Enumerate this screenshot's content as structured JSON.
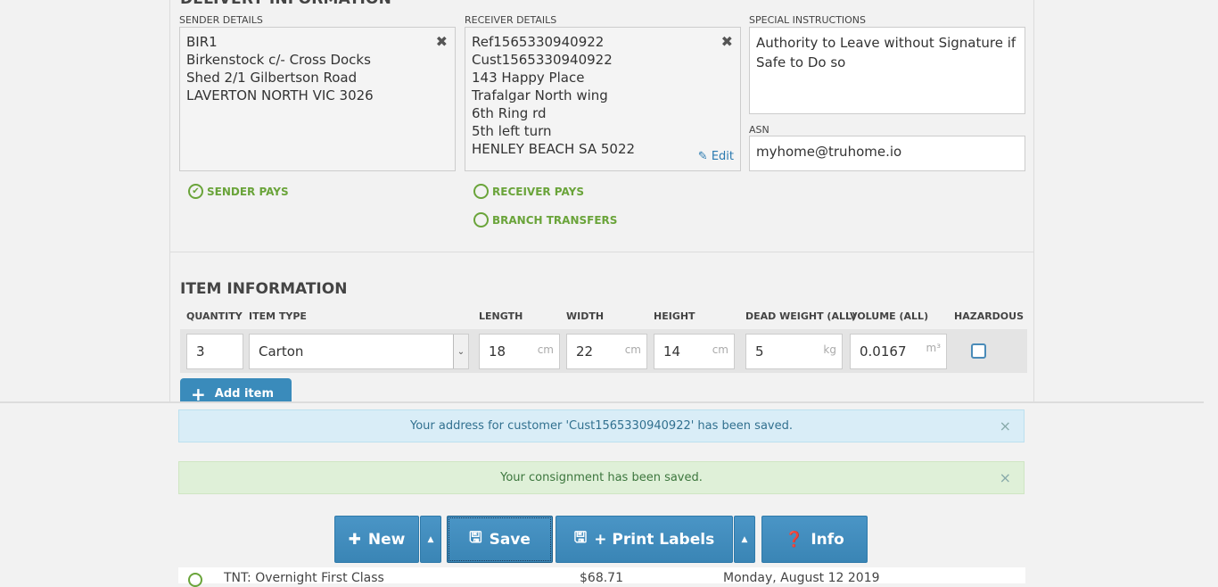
{
  "delivery": {
    "heading": "DELIVERY INFORMATION",
    "sender": {
      "label": "SENDER DETAILS",
      "lines": [
        "BIR1",
        "Birkenstock c/- Cross Docks",
        "Shed 2/1 Gilbertson Road",
        "LAVERTON NORTH VIC 3026"
      ]
    },
    "receiver": {
      "label": "RECEIVER DETAILS",
      "lines": [
        "Ref1565330940922",
        "Cust1565330940922",
        "143 Happy Place",
        "Trafalgar North wing",
        "6th Ring rd",
        "5th left turn",
        "HENLEY BEACH SA 5022"
      ],
      "edit_label": "Edit"
    },
    "special": {
      "label": "SPECIAL INSTRUCTIONS",
      "value": "Authority to Leave without Signature if Safe to Do so"
    },
    "asn": {
      "label": "ASN",
      "value": "myhome@truhome.io"
    },
    "payment": {
      "sender_pays": "SENDER PAYS",
      "receiver_pays": "RECEIVER PAYS",
      "branch_transfers": "BRANCH TRANSFERS",
      "selected": "sender_pays"
    }
  },
  "items": {
    "heading": "ITEM INFORMATION",
    "columns": [
      "QUANTITY",
      "ITEM TYPE",
      "LENGTH",
      "WIDTH",
      "HEIGHT",
      "DEAD WEIGHT (ALL)",
      "VOLUME (ALL)",
      "HAZARDOUS"
    ],
    "row": {
      "quantity": "3",
      "item_type": "Carton",
      "length": "18",
      "length_unit": "cm",
      "width": "22",
      "width_unit": "cm",
      "height": "14",
      "height_unit": "cm",
      "weight": "5",
      "weight_unit": "kg",
      "volume": "0.0167",
      "volume_unit": "m³",
      "hazardous": false
    },
    "add_line_label": "Add item line"
  },
  "alerts": {
    "info": "Your address for customer 'Cust1565330940922' has been saved.",
    "success": "Your consignment has been saved.",
    "close_glyph": "×"
  },
  "actions": {
    "new": "New",
    "save": "Save",
    "print": "+ Print Labels",
    "info": "Info"
  },
  "service_row": {
    "name": "TNT: Overnight First Class",
    "price": "$68.71",
    "date": "Monday, August 12 2019"
  },
  "colors": {
    "accent": "#428bca",
    "green": "#6aa43a",
    "info_bg": "#d9edf7",
    "success_bg": "#dff0d8"
  }
}
